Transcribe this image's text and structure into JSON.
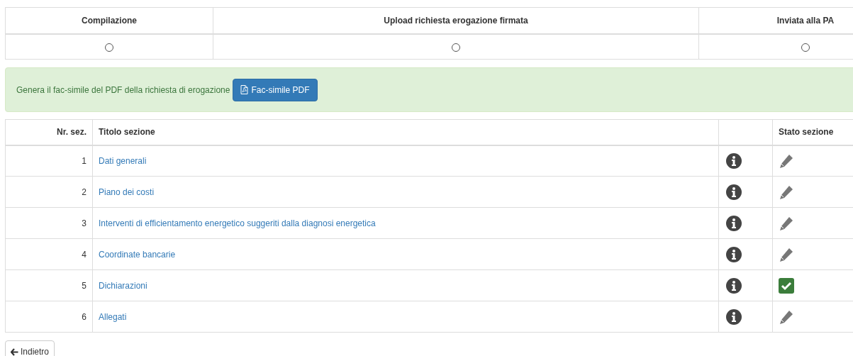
{
  "steps": [
    {
      "label": "Compilazione",
      "checked": false
    },
    {
      "label": "Upload richiesta erogazione firmata",
      "checked": false
    },
    {
      "label": "Inviata alla PA",
      "checked": false
    }
  ],
  "alert": {
    "text": "Genera il fac-simile del PDF della richiesta di erogazione",
    "button": "Fac-simile PDF"
  },
  "table": {
    "columns": [
      "Nr. sez.",
      "Titolo sezione",
      "Stato sezione"
    ],
    "rows": [
      {
        "number": "1",
        "title": "Dati generali",
        "complete": false
      },
      {
        "number": "2",
        "title": "Piano dei costi",
        "complete": false
      },
      {
        "number": "3",
        "title": "Interventi di efficientamento energetico suggeriti dalla diagnosi energetica",
        "complete": false
      },
      {
        "number": "4",
        "title": "Coordinate bancarie",
        "complete": false
      },
      {
        "number": "5",
        "title": "Dichiarazioni",
        "complete": true
      },
      {
        "number": "6",
        "title": "Allegati",
        "complete": false
      }
    ]
  },
  "back_button": "Indietro"
}
